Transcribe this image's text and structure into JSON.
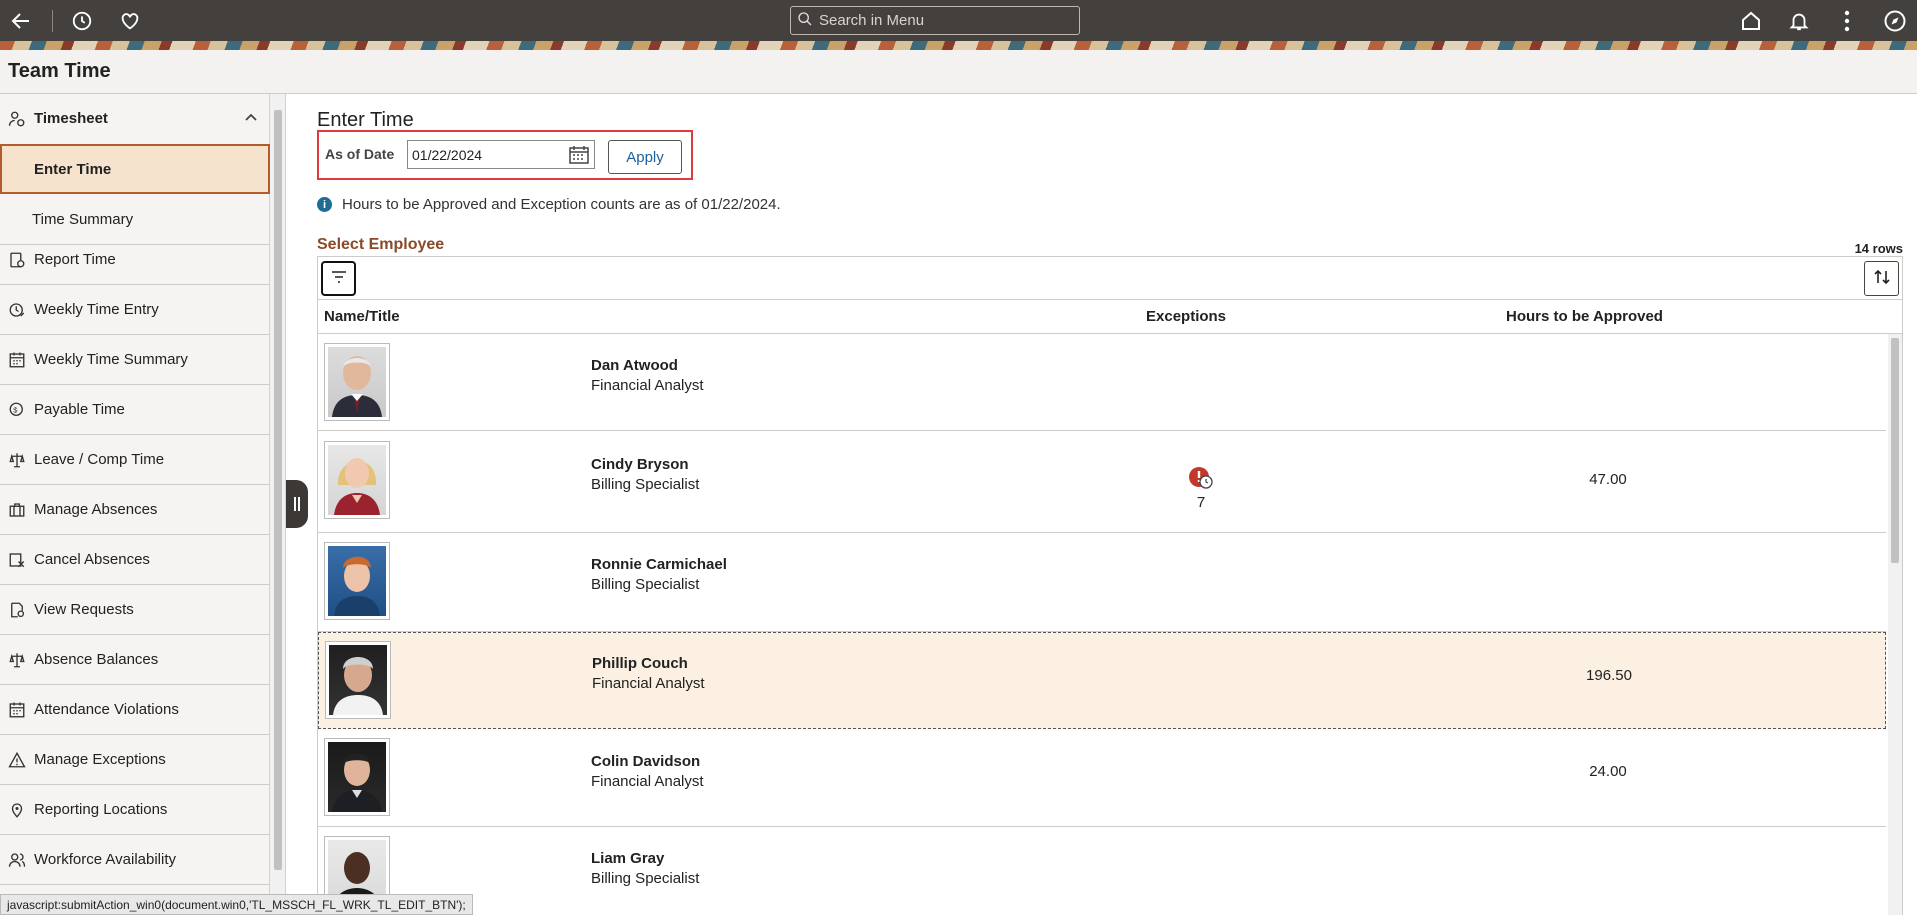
{
  "topbar": {
    "search_placeholder": "Search in Menu",
    "icons": [
      "back-arrow-icon",
      "history-icon",
      "favorites-heart-icon",
      "home-icon",
      "bell-icon",
      "kebab-menu-icon",
      "compass-icon"
    ]
  },
  "page": {
    "title": "Team Time"
  },
  "sidebar": {
    "group": "Timesheet",
    "items": [
      {
        "label": "Enter Time",
        "icon": "",
        "active": true
      },
      {
        "label": "Time Summary",
        "icon": ""
      },
      {
        "label": "Report Time",
        "icon": "clipboard-clock-icon"
      },
      {
        "label": "Weekly Time Entry",
        "icon": "clock-pencil-icon"
      },
      {
        "label": "Weekly Time Summary",
        "icon": "calendar-grid-icon"
      },
      {
        "label": "Payable Time",
        "icon": "money-clock-icon"
      },
      {
        "label": "Leave / Comp Time",
        "icon": "scale-icon"
      },
      {
        "label": "Manage Absences",
        "icon": "briefcase-icon"
      },
      {
        "label": "Cancel Absences",
        "icon": "calendar-x-icon"
      },
      {
        "label": "View Requests",
        "icon": "document-search-icon"
      },
      {
        "label": "Absence Balances",
        "icon": "scale-icon"
      },
      {
        "label": "Attendance Violations",
        "icon": "calendar-grid-icon"
      },
      {
        "label": "Manage Exceptions",
        "icon": "warning-triangle-icon"
      },
      {
        "label": "Reporting Locations",
        "icon": "location-pin-icon"
      },
      {
        "label": "Workforce Availability",
        "icon": "people-icon"
      }
    ]
  },
  "main": {
    "heading": "Enter Time",
    "as_of_label": "As of Date",
    "as_of_value": "01/22/2024",
    "apply_label": "Apply",
    "info_text": "Hours to be Approved and Exception counts are as of 01/22/2024.",
    "select_title": "Select Employee",
    "row_count": "14 rows",
    "columns": {
      "name": "Name/Title",
      "exceptions": "Exceptions",
      "hours": "Hours to be Approved"
    },
    "employees": [
      {
        "name": "Dan Atwood",
        "title": "Financial Analyst",
        "exceptions": "",
        "hours": ""
      },
      {
        "name": "Cindy Bryson",
        "title": "Billing Specialist",
        "exceptions": "7",
        "hours": "47.00"
      },
      {
        "name": "Ronnie Carmichael",
        "title": "Billing Specialist",
        "exceptions": "",
        "hours": ""
      },
      {
        "name": "Phillip Couch",
        "title": "Financial Analyst",
        "exceptions": "",
        "hours": "196.50",
        "selected": true
      },
      {
        "name": "Colin Davidson",
        "title": "Financial Analyst",
        "exceptions": "",
        "hours": "24.00"
      },
      {
        "name": "Liam Gray",
        "title": "Billing Specialist",
        "exceptions": "",
        "hours": ""
      }
    ]
  },
  "status_text": "javascript:submitAction_win0(document.win0,'TL_MSSCH_FL_WRK_TL_EDIT_BTN');",
  "colors": {
    "topbar": "#44403d",
    "accent": "#b45b2b",
    "selected_row": "#fbf0e2",
    "exception_red": "#c0392b",
    "link_blue": "#1c5f9e"
  }
}
